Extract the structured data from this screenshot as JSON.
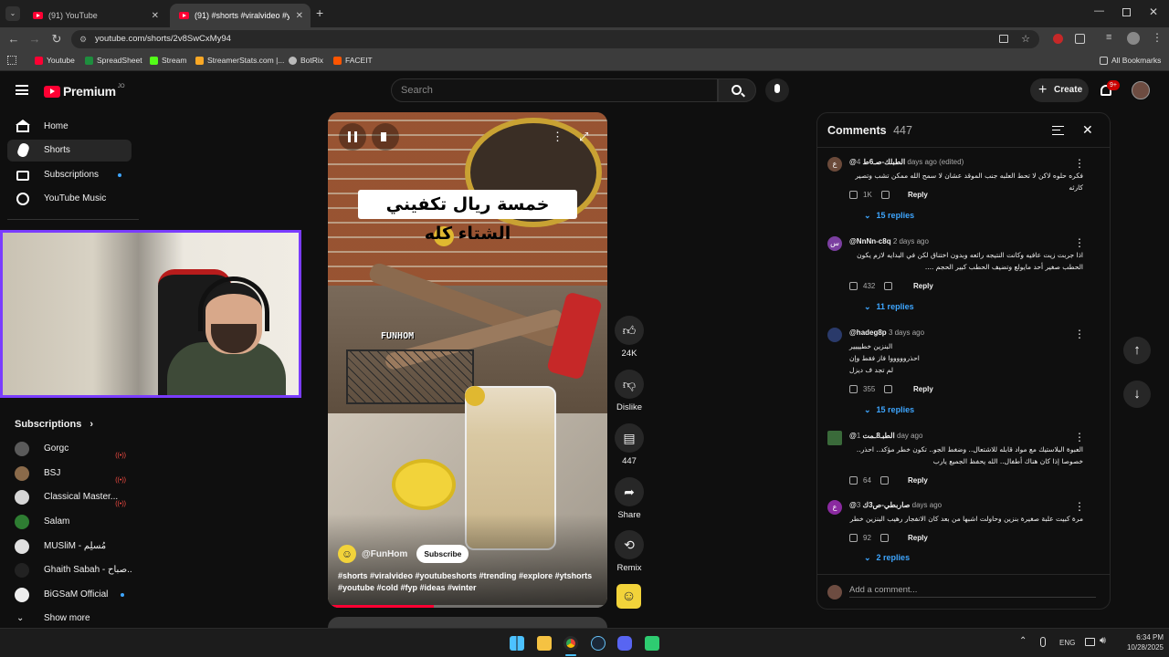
{
  "browser": {
    "tabs": [
      {
        "title": "(91) YouTube"
      },
      {
        "title": "(91) #shorts #viralvideo #yo"
      }
    ],
    "url": "youtube.com/shorts/2v8SwCxMy94",
    "bookmarks": [
      "Youtube",
      "SpreadSheet",
      "Stream",
      "StreamerStats.com |...",
      "BotRix",
      "FACEIT"
    ],
    "all_bookmarks": "All Bookmarks"
  },
  "header": {
    "logo": "Premium",
    "logo_badge": "JO",
    "search_placeholder": "Search",
    "create_label": "Create",
    "notif_count": "9+"
  },
  "sidebar": {
    "nav": [
      {
        "label": "Home",
        "icon": "home-icon"
      },
      {
        "label": "Shorts",
        "icon": "shorts-icon"
      },
      {
        "label": "Subscriptions",
        "icon": "subscriptions-icon"
      },
      {
        "label": "YouTube Music",
        "icon": "youtube-music-icon"
      }
    ],
    "subs_heading": "Subscriptions",
    "subscriptions": [
      {
        "name": "Gorgc",
        "status": "live",
        "color": "#5a5a5a"
      },
      {
        "name": "BSJ",
        "status": "live",
        "color": "#8a6a4a"
      },
      {
        "name": "Classical Master...",
        "status": "live",
        "color": "#d6d6d6"
      },
      {
        "name": "Salam",
        "status": "",
        "color": "#2e7d32"
      },
      {
        "name": "MUSliM - مُسلِم",
        "status": "",
        "color": "#e0e0e0"
      },
      {
        "name": "Ghaith Sabah - صباح...",
        "status": "",
        "color": "#222222"
      },
      {
        "name": "BiGSaM Official",
        "status": "new",
        "color": "#eeeeee"
      }
    ],
    "show_more": "Show more"
  },
  "video": {
    "caption": "خمسة ريال تكفيني الشتاء كله",
    "watermark": "FUNHOM",
    "channel": "@FunHom",
    "subscribe_label": "Subscribe",
    "hashtags": "#shorts #viralvideo #youtubeshorts #trending #explore #ytshorts #youtube #cold  #fyp #ideas #winter",
    "progress": 0.38
  },
  "actions": {
    "likes": "24K",
    "dislike": "Dislike",
    "comments": "447",
    "share": "Share",
    "remix": "Remix"
  },
  "comments_panel": {
    "title": "Comments",
    "count": "447",
    "add_placeholder": "Add a comment...",
    "items": [
      {
        "author": "@الطبلك-صـ6ط",
        "time": "4 days ago (edited)",
        "text": "فكره حلوه لاكن لا تحط العلبه جنب الموقد عشان لا سمح الله ممكن تشب وتصير كارثه",
        "likes": "1K",
        "replies": "15 replies",
        "avatar": "ع",
        "color": "#6b4a3a"
      },
      {
        "author": "@NnNn-c8q",
        "time": "2 days ago",
        "text": "اذا جربت زيت عافيه وكانت النتيجه رائعه وبدون اختناق لكن في البدايه لازم يكون الحطب صغير أحد مايولع وتضيف الحطب كبير الحجم ....",
        "likes": "432",
        "replies": "11 replies",
        "avatar": "س",
        "color": "#7b3fa0"
      },
      {
        "author": "@hadeg8p",
        "time": "3 days ago",
        "text": "البنزين خطيييير احذروووووا فاز فقط وإن لم تجد ف ديزل",
        "likes": "355",
        "replies": "15 replies",
        "avatar": "",
        "color": "#2a3a6a"
      },
      {
        "author": "@الطبـ8ـمت",
        "time": "1 day ago",
        "text": "العبوة البلاستيك مع مواد قابله للاشتعال.. وضغط الجو.. تكون خطر مؤكد.. احذر.. خصوصا إذا كان هناك أطفال.. الله يحفظ الجميع يارب",
        "likes": "64",
        "replies": "",
        "avatar": "",
        "color": "#3a6a3a"
      },
      {
        "author": "@صاربطي-ص3ك",
        "time": "3 days ago",
        "text": "مرة كبيت علبة صغيرة بنزين وحاولت اشبها من بعد كان الانفجار رهيب البنزين خطر",
        "likes": "92",
        "replies": "2 replies",
        "avatar": "ع",
        "color": "#8a2aa0"
      }
    ],
    "reply_label": "Reply"
  },
  "taskbar": {
    "lang": "ENG",
    "time": "6:34 PM",
    "date": "10/28/2025"
  }
}
